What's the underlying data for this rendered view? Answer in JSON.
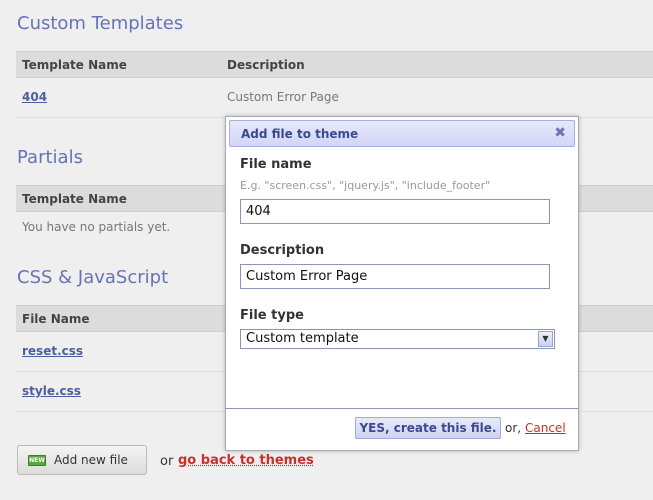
{
  "custom_templates": {
    "title": "Custom Templates",
    "headers": [
      "Template Name",
      "Description"
    ],
    "rows": [
      {
        "name": "404",
        "description": "Custom Error Page"
      }
    ]
  },
  "partials": {
    "title": "Partials",
    "headers": [
      "Template Name"
    ],
    "empty_text": "You have no partials yet."
  },
  "css_js": {
    "title": "CSS & JavaScript",
    "headers": [
      "File Name"
    ],
    "rows": [
      {
        "name": "reset.css"
      },
      {
        "name": "style.css"
      }
    ]
  },
  "footer": {
    "add_button_icon_text": "NEW",
    "add_button_label": "Add new file",
    "or_text": "or",
    "back_link": "go back to themes"
  },
  "dialog": {
    "title": "Add file to theme",
    "close_glyph": "✖",
    "file_name_label": "File name",
    "file_name_hint": "E.g. \"screen.css\", \"jquery.js\", \"include_footer\"",
    "file_name_value": "404",
    "description_label": "Description",
    "description_value": "Custom Error Page",
    "file_type_label": "File type",
    "file_type_value": "Custom template",
    "confirm_button": "YES, create this file.",
    "or_text": "or,",
    "cancel_link": "Cancel"
  }
}
